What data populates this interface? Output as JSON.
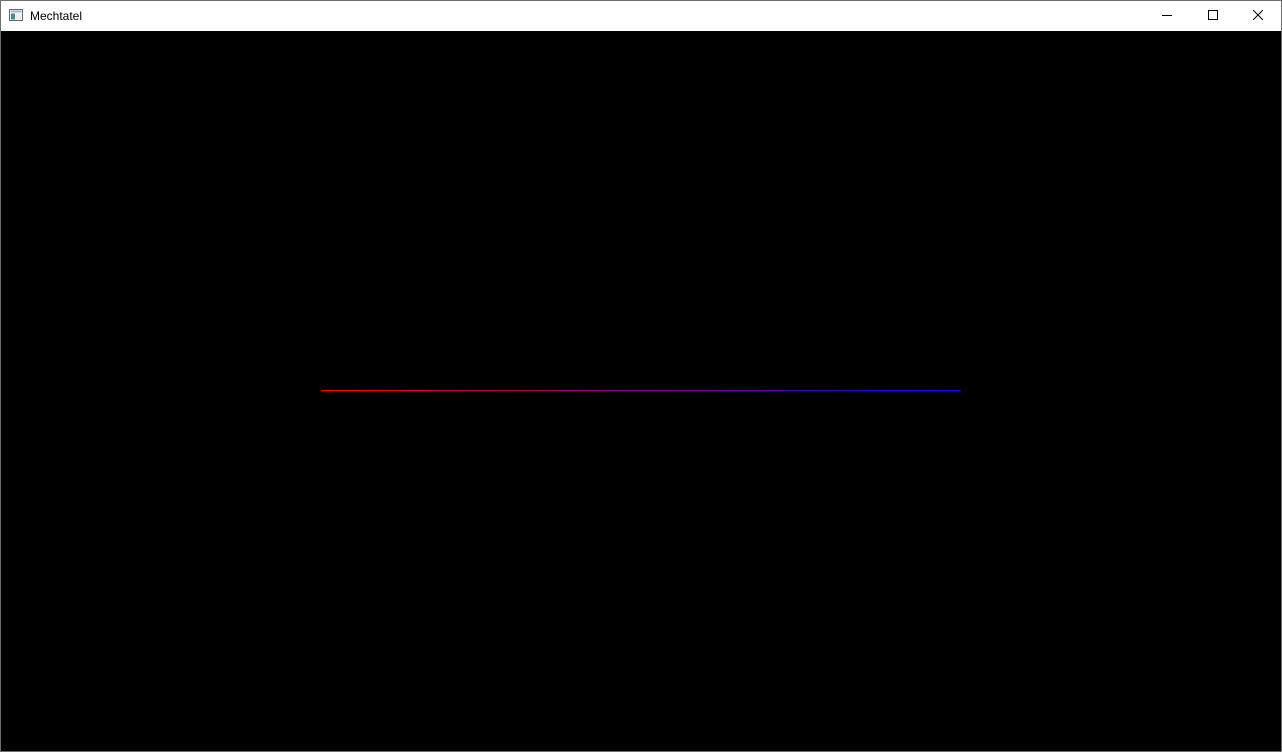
{
  "window": {
    "title": "Mechtatel",
    "icon": "app-window-icon",
    "controls": {
      "minimize_icon": "minimize-icon",
      "maximize_icon": "maximize-icon",
      "close_icon": "close-icon"
    }
  },
  "scene": {
    "background": "#000000",
    "line": {
      "start_color": "#ff0000",
      "end_color": "#0000ff"
    }
  }
}
